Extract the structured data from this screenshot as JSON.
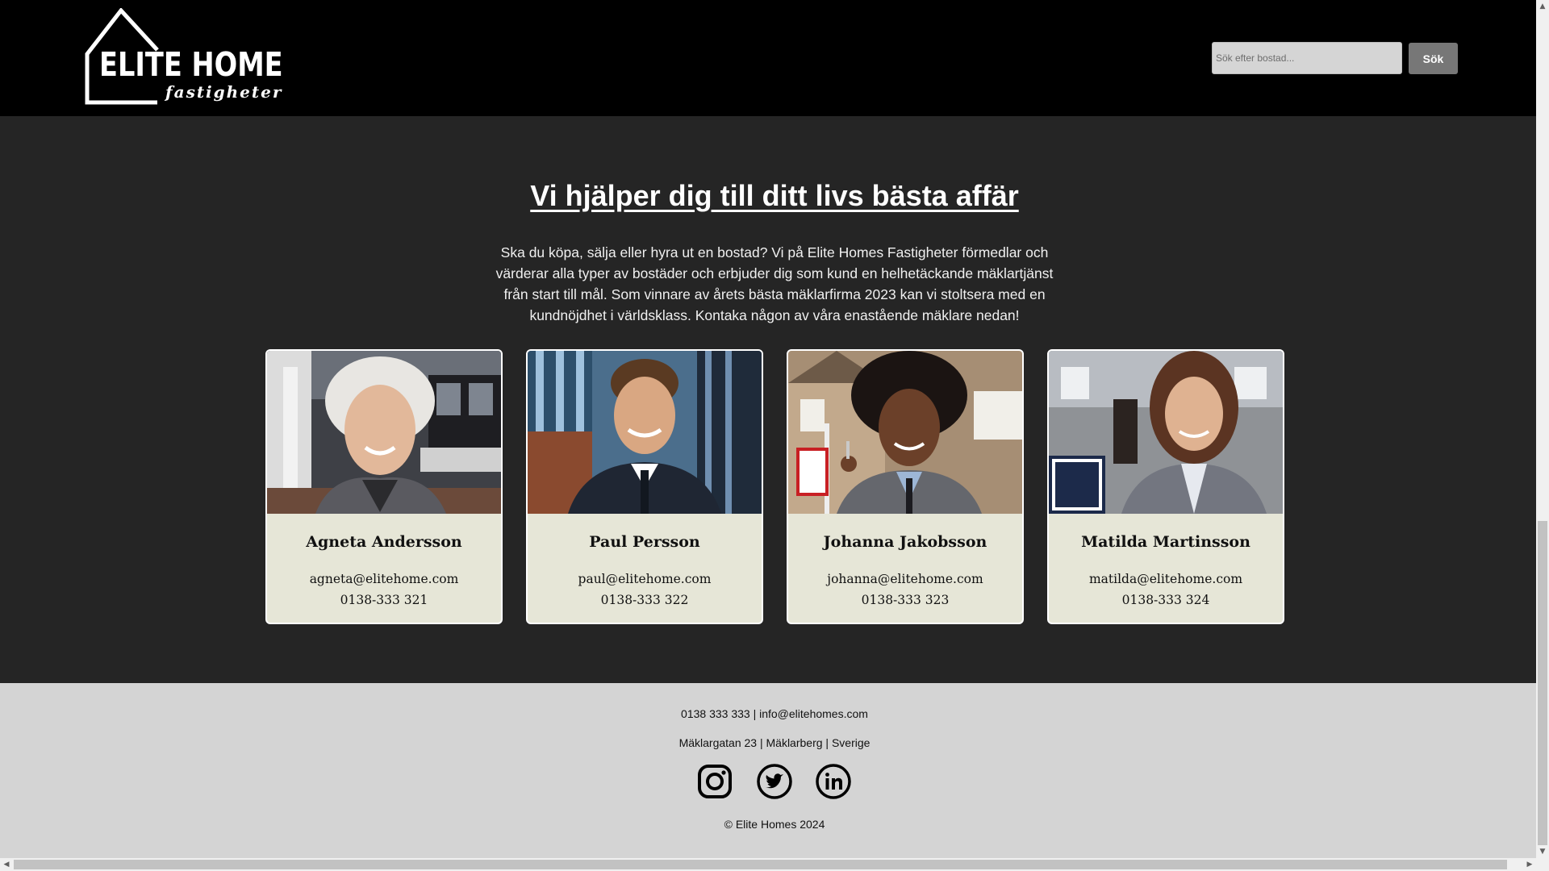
{
  "header": {
    "logo": {
      "title": "ELITE HOME",
      "subtitle": "fastigheter"
    },
    "search": {
      "placeholder": "Sök efter bostad...",
      "button_label": "Sök"
    }
  },
  "main": {
    "title": "Vi hjälper dig till ditt livs bästa affär",
    "intro": "Ska du köpa, sälja eller hyra ut en bostad? Vi på Elite Homes Fastigheter förmedlar och värderar alla typer av bostäder och erbjuder dig som kund en helhetäckande mäklartjänst från start till mål. Som vinnare av årets bästa mäklarfirma 2023 kan vi stoltsera med en kundnöjdhet i världsklass. Kontaka någon av våra enastående mäklare nedan!",
    "agents": [
      {
        "name": "Agneta Andersson",
        "email": "agneta@elitehome.com",
        "phone": "0138-333 321"
      },
      {
        "name": "Paul Persson",
        "email": "paul@elitehome.com",
        "phone": "0138-333 322"
      },
      {
        "name": "Johanna Jakobsson",
        "email": "johanna@elitehome.com",
        "phone": "0138-333 323"
      },
      {
        "name": "Matilda Martinsson",
        "email": "matilda@elitehome.com",
        "phone": "0138-333 324"
      }
    ]
  },
  "footer": {
    "contact": "0138 333 333 | info@elitehomes.com",
    "address": "Mäklargatan 23 | Mäklarberg | Sverige",
    "social_icons": [
      "instagram-icon",
      "twitter-icon",
      "linkedin-icon"
    ],
    "copyright": "© Elite Homes 2024"
  },
  "colors": {
    "header_bg": "#000000",
    "main_bg": "#252525",
    "card_bg": "#e6e6d7",
    "footer_bg": "#d4d4d4",
    "search_button_bg": "#777777"
  }
}
